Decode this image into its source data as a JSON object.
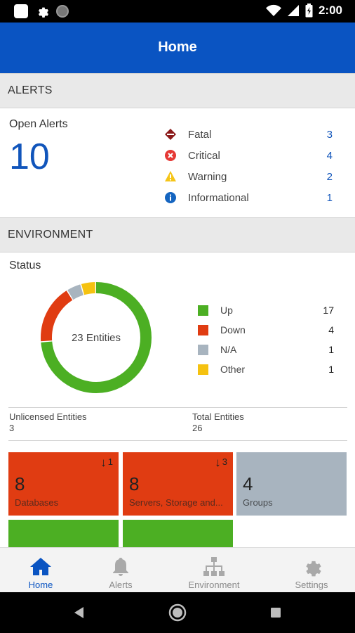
{
  "status_bar": {
    "time": "2:00"
  },
  "app_bar": {
    "title": "Home"
  },
  "alerts": {
    "header": "ALERTS",
    "open_label": "Open Alerts",
    "open_count": "10",
    "items": [
      {
        "label": "Fatal",
        "count": "3",
        "icon": "fatal-diamond-icon",
        "color": "#8b1a1a"
      },
      {
        "label": "Critical",
        "count": "4",
        "icon": "critical-x-circle-icon",
        "color": "#e53935"
      },
      {
        "label": "Warning",
        "count": "2",
        "icon": "warning-triangle-icon",
        "color": "#f5c518"
      },
      {
        "label": "Informational",
        "count": "1",
        "icon": "info-circle-icon",
        "color": "#1565c0"
      }
    ]
  },
  "environment": {
    "header": "ENVIRONMENT",
    "status_label": "Status",
    "donut_center": "23 Entities",
    "legend": [
      {
        "label": "Up",
        "value": "17",
        "color": "#4caf23"
      },
      {
        "label": "Down",
        "value": "4",
        "color": "#e03c12"
      },
      {
        "label": "N/A",
        "value": "1",
        "color": "#a8b4bf"
      },
      {
        "label": "Other",
        "value": "1",
        "color": "#f5c211"
      }
    ],
    "unlicensed_label": "Unlicensed Entities",
    "unlicensed_value": "3",
    "total_label": "Total Entities",
    "total_value": "26",
    "tiles": [
      {
        "number": "8",
        "label": "Databases",
        "trend": "1",
        "color": "#e03c12"
      },
      {
        "number": "8",
        "label": "Servers, Storage and...",
        "trend": "3",
        "color": "#e03c12"
      },
      {
        "number": "4",
        "label": "Groups",
        "trend": "",
        "color": "#a8b4bf"
      },
      {
        "number": "",
        "label": "",
        "trend": "",
        "color": "#4caf23"
      },
      {
        "number": "",
        "label": "",
        "trend": "",
        "color": "#4caf23"
      }
    ]
  },
  "bottom_nav": [
    {
      "label": "Home",
      "icon": "home-icon",
      "active": true
    },
    {
      "label": "Alerts",
      "icon": "bell-icon",
      "active": false
    },
    {
      "label": "Environment",
      "icon": "hierarchy-icon",
      "active": false
    },
    {
      "label": "Settings",
      "icon": "gear-icon",
      "active": false
    }
  ],
  "colors": {
    "primary": "#0a54c2",
    "accent_text": "#1155bb"
  }
}
